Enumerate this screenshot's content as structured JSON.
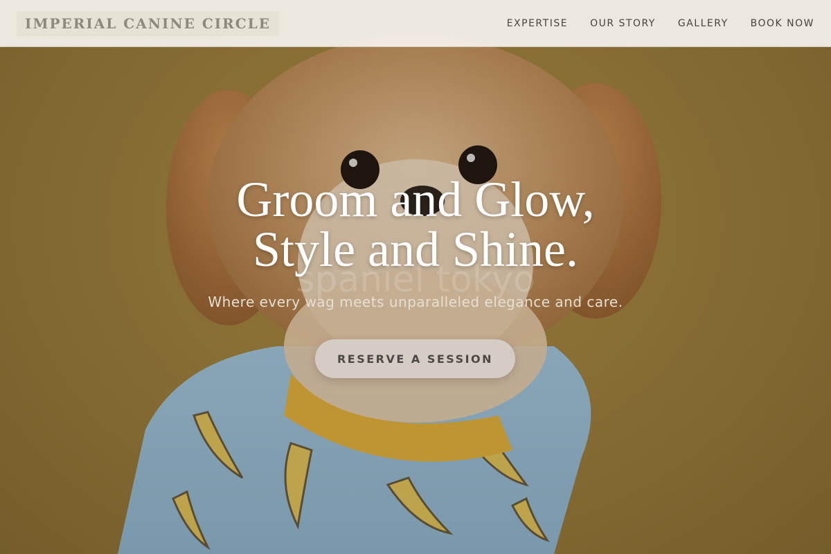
{
  "brand": {
    "name": "IMPERIAL CANINE CIRCLE"
  },
  "nav": {
    "items": [
      {
        "label": "EXPERTISE"
      },
      {
        "label": "OUR STORY"
      },
      {
        "label": "GALLERY"
      },
      {
        "label": "BOOK NOW"
      }
    ]
  },
  "hero": {
    "title_line1": "Groom and Glow,",
    "title_line2": "Style and Shine.",
    "subtitle": "Where every wag meets unparalleled elegance and care.",
    "cta_label": "RESERVE A SESSION",
    "watermark_text": "spaniel tokyo"
  },
  "colors": {
    "background_mustard": "#a4853f",
    "navbar_bg": "#f5f2ec",
    "logo_text": "#8c8a7c",
    "cta_bg": "#d5cdc5",
    "title_text": "#ffffff"
  }
}
